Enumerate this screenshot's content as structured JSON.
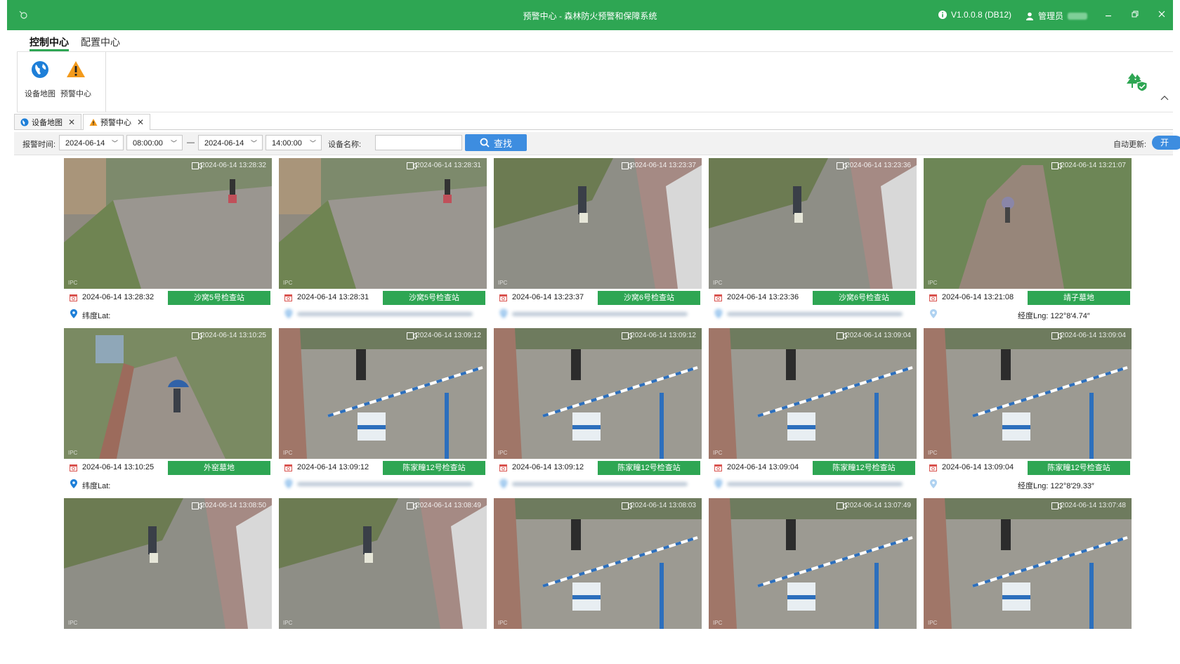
{
  "window": {
    "title": "预警中心 - 森林防火预警和保障系统",
    "version": "V1.0.0.8 (DB12)",
    "user_label": "管理员"
  },
  "menu": {
    "tabs": [
      {
        "label": "控制中心",
        "active": true
      },
      {
        "label": "配置中心",
        "active": false
      }
    ]
  },
  "ribbon": {
    "buttons": [
      {
        "label": "设备地图",
        "icon": "globe-icon"
      },
      {
        "label": "预警中心",
        "icon": "warning-icon"
      }
    ]
  },
  "doc_tabs": [
    {
      "label": "设备地图",
      "icon": "globe-icon",
      "active": false
    },
    {
      "label": "预警中心",
      "icon": "warning-icon",
      "active": true
    }
  ],
  "filter": {
    "time_label": "报警时间:",
    "start_date": "2024-06-14",
    "start_time": "08:00:00",
    "separator": "—",
    "end_date": "2024-06-14",
    "end_time": "14:00:00",
    "device_label": "设备名称:",
    "device_value": "",
    "search_label": "查找",
    "auto_label": "自动更新:",
    "auto_value": "开"
  },
  "cards": [
    {
      "overlay_time": "2024-06-14 13:28:32",
      "time": "2024-06-14 13:28:32",
      "location": "沙窝5号检查站",
      "lat": "纬度Lat:",
      "lng": "",
      "scene": "road"
    },
    {
      "overlay_time": "2024-06-14 13:28:31",
      "time": "2024-06-14 13:28:31",
      "location": "沙窝5号检查站",
      "lat": "",
      "lng": "",
      "scene": "road"
    },
    {
      "overlay_time": "2024-06-14 13:23:37",
      "time": "2024-06-14 13:23:37",
      "location": "沙窝6号检查站",
      "lat": "",
      "lng": "",
      "scene": "station"
    },
    {
      "overlay_time": "2024-06-14 13:23:36",
      "time": "2024-06-14 13:23:36",
      "location": "沙窝6号检查站",
      "lat": "",
      "lng": "",
      "scene": "station"
    },
    {
      "overlay_time": "2024-06-14 13:21:07",
      "time": "2024-06-14 13:21:08",
      "location": "靖子墓地",
      "lat": "",
      "lng": "经度Lng: 122°8′4.74″",
      "scene": "path"
    },
    {
      "overlay_time": "2024-06-14 13:10:25",
      "time": "2024-06-14 13:10:25",
      "location": "外窑墓地",
      "lat": "纬度Lat:",
      "lng": "",
      "scene": "wall"
    },
    {
      "overlay_time": "2024-06-14 13:09:12",
      "time": "2024-06-14 13:09:12",
      "location": "陈家疃12号检查站",
      "lat": "",
      "lng": "",
      "scene": "barrier"
    },
    {
      "overlay_time": "2024-06-14 13:09:12",
      "time": "2024-06-14 13:09:12",
      "location": "陈家疃12号检查站",
      "lat": "",
      "lng": "",
      "scene": "barrier"
    },
    {
      "overlay_time": "2024-06-14 13:09:04",
      "time": "2024-06-14 13:09:04",
      "location": "陈家疃12号检查站",
      "lat": "",
      "lng": "",
      "scene": "barrier"
    },
    {
      "overlay_time": "2024-06-14 13:09:04",
      "time": "2024-06-14 13:09:04",
      "location": "陈家疃12号检查站",
      "lat": "",
      "lng": "经度Lng: 122°8′29.33″",
      "scene": "barrier"
    },
    {
      "overlay_time": "2024-06-14 13:08:50",
      "time": "",
      "location": "",
      "lat": "",
      "lng": "",
      "scene": "station"
    },
    {
      "overlay_time": "2024-06-14 13:08:49",
      "time": "",
      "location": "",
      "lat": "",
      "lng": "",
      "scene": "station"
    },
    {
      "overlay_time": "2024-06-14 13:08:03",
      "time": "",
      "location": "",
      "lat": "",
      "lng": "",
      "scene": "barrier"
    },
    {
      "overlay_time": "2024-06-14 13:07:49",
      "time": "",
      "location": "",
      "lat": "",
      "lng": "",
      "scene": "barrier"
    },
    {
      "overlay_time": "2024-06-14 13:07:48",
      "time": "",
      "location": "",
      "lat": "",
      "lng": "",
      "scene": "barrier"
    }
  ],
  "overlay_label": "IPC",
  "colors": {
    "brand": "#2ea653",
    "accent": "#3d8de0"
  }
}
